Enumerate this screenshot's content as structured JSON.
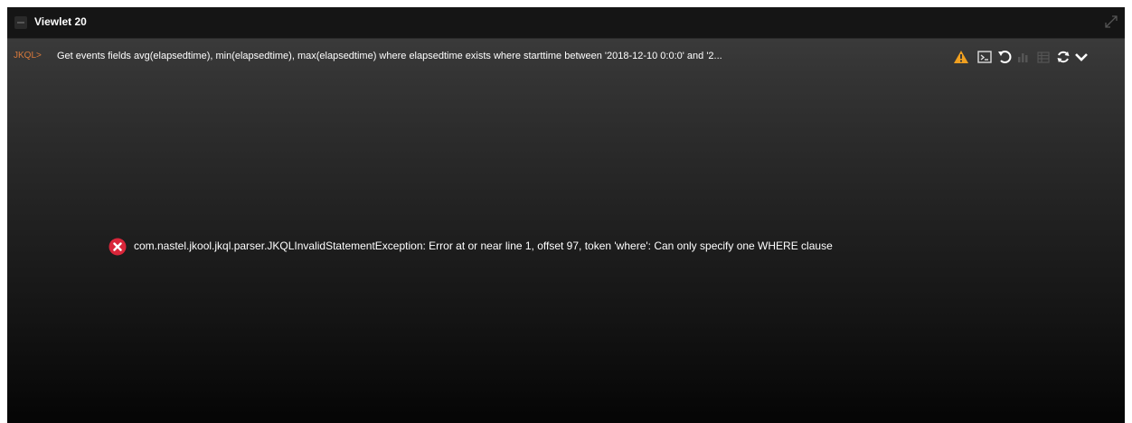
{
  "viewlet": {
    "title": "Viewlet 20",
    "handle_icon": "drag-handle-icon",
    "expand_icon": "expand-icon"
  },
  "query": {
    "prefix": "JKQL>",
    "text": "Get events fields avg(elapsedtime), min(elapsedtime), max(elapsedtime) where elapsedtime exists where starttime between '2018-12-10 0:0:0' and '2...",
    "icons": [
      "warning-icon",
      "console-icon",
      "undo-icon",
      "chart-icon",
      "table-icon",
      "refresh-icon",
      "chevron-down-icon"
    ]
  },
  "error": {
    "icon": "error-icon",
    "message": "com.nastel.jkool.jkql.parser.JKQLInvalidStatementException: Error at or near line 1, offset 97, token 'where': Can only specify one WHERE clause"
  },
  "colors": {
    "prefix": "#d8793b",
    "warning": "#f0a020",
    "error": "#d9263a",
    "titlebar": "#151515"
  }
}
